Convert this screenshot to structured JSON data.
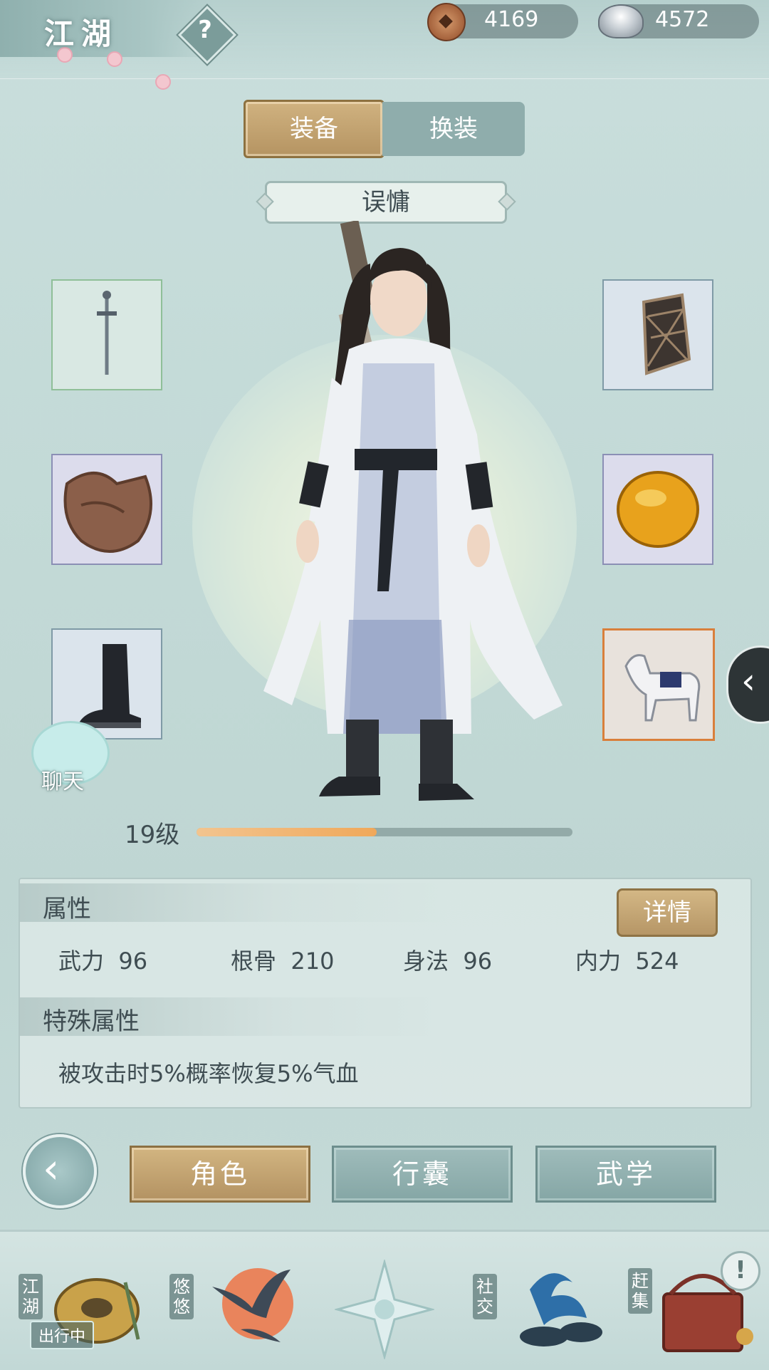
{
  "header": {
    "title": "江湖",
    "currency": [
      {
        "icon": "copper-coin-icon",
        "value": "4169"
      },
      {
        "icon": "silver-ingot-icon",
        "value": "4572"
      }
    ]
  },
  "tabs": [
    {
      "label": "装备",
      "active": true
    },
    {
      "label": "换装",
      "active": false
    }
  ],
  "character": {
    "name": "误慵",
    "level_label": "19级",
    "exp_progress": 0.48
  },
  "equipment": {
    "left": [
      {
        "icon": "sword-icon"
      },
      {
        "icon": "armor-icon"
      },
      {
        "icon": "boot-icon"
      }
    ],
    "right": [
      {
        "icon": "bracer-icon"
      },
      {
        "icon": "amber-gem-icon"
      },
      {
        "icon": "horse-mount-icon"
      }
    ]
  },
  "chat": {
    "label": "聊天"
  },
  "attributes": {
    "title": "属性",
    "detail_button": "详情",
    "stats": [
      {
        "name": "武力",
        "value": "96"
      },
      {
        "name": "根骨",
        "value": "210"
      },
      {
        "name": "身法",
        "value": "96"
      },
      {
        "name": "内力",
        "value": "524"
      }
    ],
    "special_title": "特殊属性",
    "special_text": "被攻击时5%概率恢复5%气血"
  },
  "menu": {
    "buttons": [
      {
        "label": "角色",
        "active": true
      },
      {
        "label": "行囊",
        "active": false
      },
      {
        "label": "武学",
        "active": false
      }
    ]
  },
  "bottom_nav": {
    "items": [
      {
        "label": "江湖",
        "status": "出行中",
        "icon": "jianghu-icon"
      },
      {
        "label": "悠悠",
        "icon": "swallow-icon"
      },
      {
        "label": "",
        "icon": "compass-star-icon"
      },
      {
        "label": "社交",
        "icon": "wave-bowl-icon"
      },
      {
        "label": "赶集",
        "icon": "market-basket-icon"
      }
    ],
    "alert": "!"
  },
  "colors": {
    "gold": "#b59462",
    "teal": "#8fadac",
    "background": "#c5dbd8",
    "exp_fill": "#f0a85a"
  }
}
